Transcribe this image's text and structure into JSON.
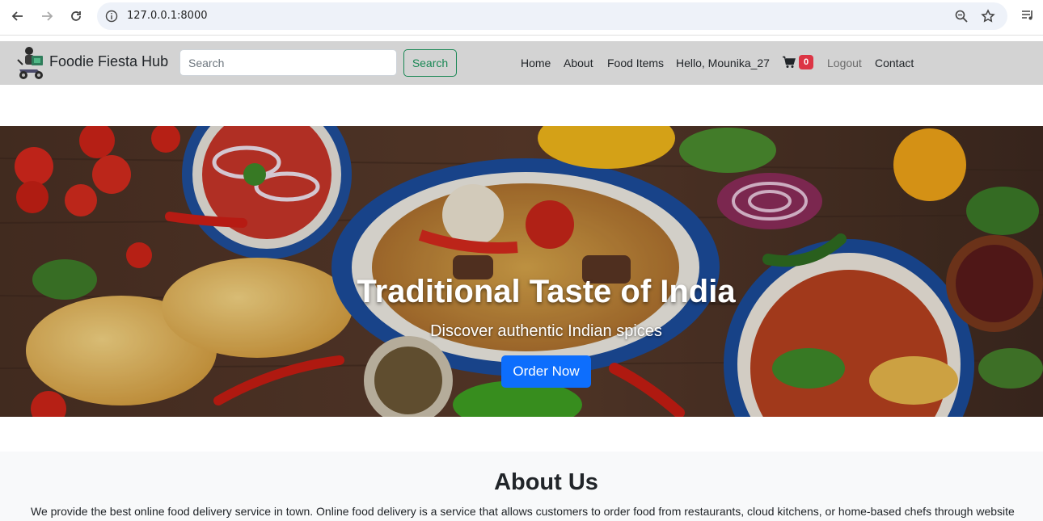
{
  "browser": {
    "url": "127.0.0.1:8000"
  },
  "navbar": {
    "brand": "Foodie Fiesta Hub",
    "search_placeholder": "Search",
    "search_button": "Search",
    "links": {
      "home": "Home",
      "about": "About",
      "food_items": "Food Items",
      "greeting": "Hello, Mounika_27",
      "logout": "Logout",
      "contact": "Contact"
    },
    "cart_count": "0"
  },
  "hero": {
    "title": "Traditional Taste of India",
    "subtitle": "Discover authentic Indian spices",
    "cta": "Order Now"
  },
  "about": {
    "title": "About Us",
    "text": "We provide the best online food delivery service in town. Online food delivery is a service that allows customers to order food from restaurants, cloud kitchens, or home-based chefs through website"
  },
  "colors": {
    "navbar_bg": "#d3d3d3",
    "search_green": "#198754",
    "cta_blue": "#0d6efd",
    "badge_red": "#dc3545"
  }
}
